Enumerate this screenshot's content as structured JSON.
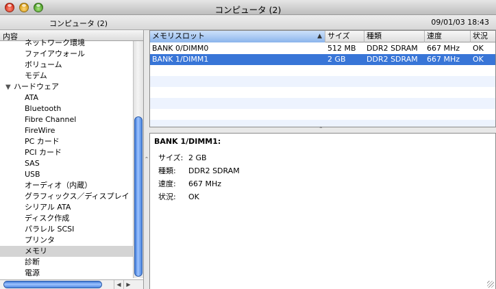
{
  "window": {
    "title": "コンピュータ (2)"
  },
  "info_bar": {
    "computer_name": "コンピュータ (2)",
    "datetime": "09/01/03 18:43"
  },
  "sidebar": {
    "header": "内容",
    "items": [
      {
        "label": "ネットワーク環境",
        "type": "item"
      },
      {
        "label": "ファイアウォール",
        "type": "item"
      },
      {
        "label": "ボリューム",
        "type": "item"
      },
      {
        "label": "モデム",
        "type": "item"
      },
      {
        "label": "ハードウェア",
        "type": "group"
      },
      {
        "label": "ATA",
        "type": "item"
      },
      {
        "label": "Bluetooth",
        "type": "item"
      },
      {
        "label": "Fibre Channel",
        "type": "item"
      },
      {
        "label": "FireWire",
        "type": "item"
      },
      {
        "label": "PC カード",
        "type": "item"
      },
      {
        "label": "PCI カード",
        "type": "item"
      },
      {
        "label": "SAS",
        "type": "item"
      },
      {
        "label": "USB",
        "type": "item"
      },
      {
        "label": "オーディオ（内蔵）",
        "type": "item"
      },
      {
        "label": "グラフィックス／ディスプレイ",
        "type": "item"
      },
      {
        "label": "シリアル ATA",
        "type": "item"
      },
      {
        "label": "ディスク作成",
        "type": "item"
      },
      {
        "label": "パラレル SCSI",
        "type": "item"
      },
      {
        "label": "プリンタ",
        "type": "item"
      },
      {
        "label": "メモリ",
        "type": "item",
        "selected": true
      },
      {
        "label": "診断",
        "type": "item"
      },
      {
        "label": "電源",
        "type": "item"
      }
    ],
    "group_expanded_icon": "triangle-down-icon"
  },
  "list": {
    "columns": [
      "メモリスロット",
      "サイズ",
      "種類",
      "速度",
      "状況"
    ],
    "sort_icon": "sort-ascending-icon",
    "rows": [
      [
        "BANK 0/DIMM0",
        "512 MB",
        "DDR2 SDRAM",
        "667 MHz",
        "OK"
      ],
      [
        "BANK 1/DIMM1",
        "2 GB",
        "DDR2 SDRAM",
        "667 MHz",
        "OK"
      ]
    ],
    "selected_row": 1
  },
  "detail": {
    "title": "BANK 1/DIMM1:",
    "properties": [
      {
        "label": "サイズ:",
        "value": "2 GB"
      },
      {
        "label": "種類:",
        "value": "DDR2 SDRAM"
      },
      {
        "label": "速度:",
        "value": "667 MHz"
      },
      {
        "label": "状況:",
        "value": "OK"
      }
    ]
  },
  "colors": {
    "selection": "#3875d7",
    "scroll_thumb": "#4b86e0"
  }
}
